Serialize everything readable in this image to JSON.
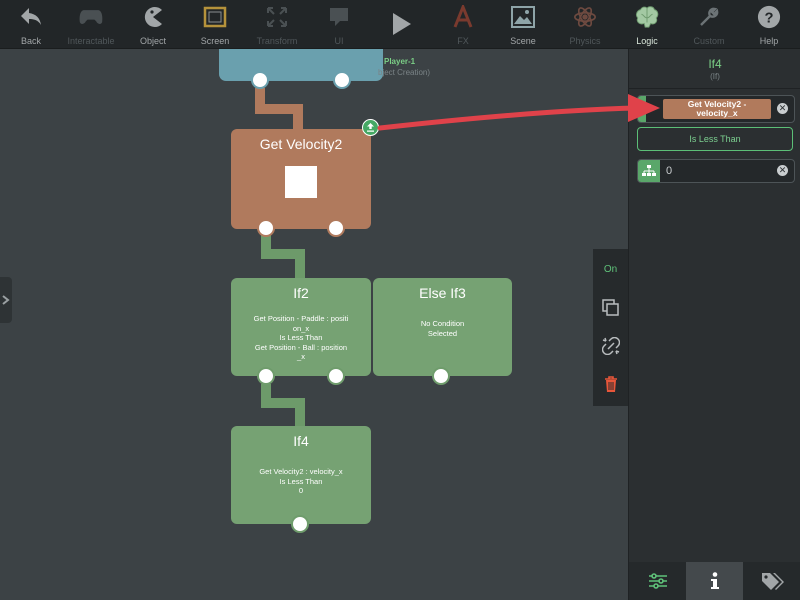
{
  "toolbar": {
    "items": [
      {
        "label": "Back",
        "icon": "back-arrow-icon",
        "state": "normal"
      },
      {
        "label": "Interactable",
        "icon": "gamepad-icon",
        "state": "dim"
      },
      {
        "label": "Object",
        "icon": "pacman-icon",
        "state": "normal"
      },
      {
        "label": "Screen",
        "icon": "screen-frame-icon",
        "state": "normal"
      },
      {
        "label": "Transform",
        "icon": "transform-arrows-icon",
        "state": "dim"
      },
      {
        "label": "UI",
        "icon": "speech-bubble-icon",
        "state": "dim"
      },
      {
        "label": "",
        "icon": "play-icon",
        "state": "normal"
      },
      {
        "label": "FX",
        "icon": "fx-icon",
        "state": "dim"
      },
      {
        "label": "Scene",
        "icon": "landscape-image-icon",
        "state": "normal"
      },
      {
        "label": "Physics",
        "icon": "atom-icon",
        "state": "dim"
      },
      {
        "label": "Logic",
        "icon": "brain-icon",
        "state": "active"
      },
      {
        "label": "Custom",
        "icon": "wrench-icon",
        "state": "dim"
      },
      {
        "label": "Help",
        "icon": "help-question-icon",
        "state": "normal"
      }
    ]
  },
  "canvas": {
    "player_node": {
      "label": "Player-1",
      "sublabel": "bject Creation)"
    },
    "velocity_node": {
      "title": "Get Velocity2"
    },
    "if2_node": {
      "title": "If2",
      "lines": [
        "Get Position - Paddle : positi",
        "on_x",
        "Is Less Than",
        "Get Position - Ball : position",
        "_x"
      ]
    },
    "elseif3_node": {
      "title": "Else If3",
      "lines": [
        "No Condition",
        "Selected"
      ]
    },
    "if4_node": {
      "title": "If4",
      "lines": [
        "Get Velocity2 : velocity_x",
        "Is Less Than",
        "0"
      ]
    },
    "action_bar": {
      "on_label": "On"
    }
  },
  "panel": {
    "title": "If4",
    "subtitle": "(If)",
    "condition_left": {
      "line1": "Get Velocity2 -",
      "line2": "velocity_x"
    },
    "operator": "Is Less Than",
    "condition_right_value": "0",
    "tabs": [
      {
        "icon": "sliders-icon",
        "selected": false
      },
      {
        "icon": "info-icon",
        "selected": true
      },
      {
        "icon": "tags-icon",
        "selected": false
      }
    ]
  },
  "colors": {
    "accent_green": "#7bcf86",
    "node_green": "#76a273",
    "node_brown": "#b07a5d",
    "node_blue": "#6aa0ae",
    "arrow_red": "#e0424a",
    "delete_red": "#e8563a"
  }
}
